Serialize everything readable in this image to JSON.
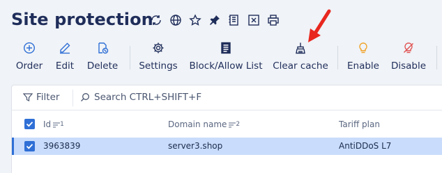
{
  "page": {
    "title": "Site protection",
    "title_icons": [
      "refresh-icon",
      "globe-icon",
      "star-icon",
      "pin-icon",
      "document-icon",
      "excel-icon",
      "print-icon"
    ]
  },
  "toolbar": {
    "items": [
      {
        "label": "Order",
        "icon": "plus-circle-icon"
      },
      {
        "label": "Edit",
        "icon": "pencil-icon"
      },
      {
        "label": "Delete",
        "icon": "delete-file-icon"
      },
      {
        "label": "Settings",
        "icon": "gear-icon"
      },
      {
        "label": "Block/Allow List",
        "icon": "list-icon"
      },
      {
        "label": "Clear cache",
        "icon": "broom-icon"
      },
      {
        "label": "Enable",
        "icon": "bulb-on-icon"
      },
      {
        "label": "Disable",
        "icon": "bulb-off-icon"
      }
    ]
  },
  "filterbar": {
    "filter_label": "Filter",
    "search_placeholder": "Search CTRL+SHIFT+F"
  },
  "table": {
    "columns": [
      {
        "label": "Id",
        "sort_index": "1"
      },
      {
        "label": "Domain name",
        "sort_index": "2"
      },
      {
        "label": "Tariff plan",
        "sort_index": ""
      }
    ],
    "rows": [
      {
        "id": "3963839",
        "domain": "server3.shop",
        "tariff": "AntiDDoS L7",
        "selected": true
      }
    ]
  },
  "colors": {
    "accent": "#2f6fd6",
    "title": "#1f2d5a",
    "row_selected": "#c9dcfb",
    "annotation_arrow": "#e8271f",
    "enable_icon": "#f0a020",
    "disable_icon": "#e05050"
  }
}
